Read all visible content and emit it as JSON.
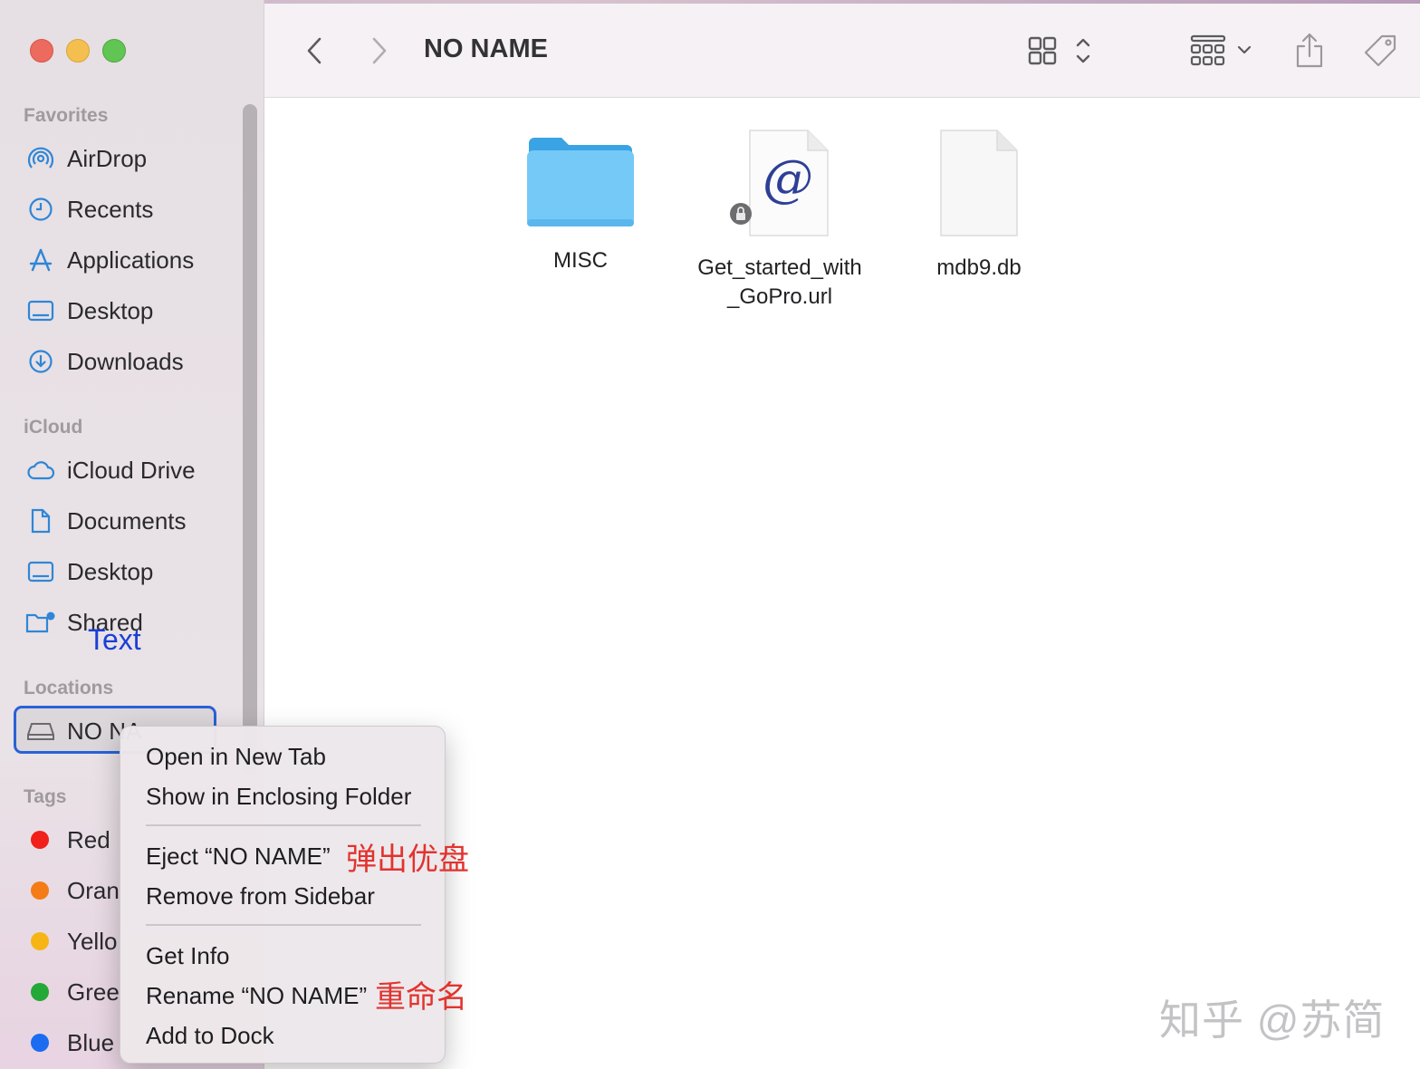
{
  "window": {
    "title": "NO NAME"
  },
  "sidebar": {
    "favorites_label": "Favorites",
    "favorites": [
      {
        "label": "AirDrop",
        "icon": "airdrop-icon"
      },
      {
        "label": "Recents",
        "icon": "clock-icon"
      },
      {
        "label": "Applications",
        "icon": "applications-icon"
      },
      {
        "label": "Desktop",
        "icon": "desktop-icon"
      },
      {
        "label": "Downloads",
        "icon": "download-icon"
      }
    ],
    "icloud_label": "iCloud",
    "icloud": [
      {
        "label": "iCloud Drive",
        "icon": "cloud-icon"
      },
      {
        "label": "Documents",
        "icon": "document-icon"
      },
      {
        "label": "Desktop",
        "icon": "desktop-icon"
      },
      {
        "label": "Shared",
        "icon": "shared-folder-icon"
      }
    ],
    "text_overlay": "Text",
    "locations_label": "Locations",
    "location_selected": {
      "label": "NO NA",
      "icon": "drive-icon"
    },
    "tags_label": "Tags",
    "tags": [
      {
        "label": "Red",
        "color": "#f0201a"
      },
      {
        "label": "Oran",
        "color": "#f47c16"
      },
      {
        "label": "Yello",
        "color": "#f7b515"
      },
      {
        "label": "Gree",
        "color": "#24a836"
      },
      {
        "label": "Blue",
        "color": "#1b6cf0"
      }
    ]
  },
  "toolbar": {
    "back_icon": "chevron-left-icon",
    "forward_icon": "chevron-right-icon",
    "view_icon": "icon-grid-icon",
    "group_icon": "group-grid-icon",
    "share_icon": "share-icon",
    "tag_icon": "tag-icon"
  },
  "files": [
    {
      "name": "MISC",
      "icon": "folder-icon"
    },
    {
      "name": "Get_started_with\n_GoPro.url",
      "name_line1": "Get_started_with",
      "name_line2": "_GoPro.url",
      "icon": "url-file-icon"
    },
    {
      "name": "mdb9.db",
      "icon": "blank-file-icon"
    }
  ],
  "context_menu": {
    "items": [
      "Open in New Tab",
      "Show in Enclosing Folder",
      "Eject “NO NAME”",
      "Remove from Sidebar",
      "Get Info",
      "Rename “NO NAME”",
      "Add to Dock"
    ],
    "annotation_eject": "弹出优盘",
    "annotation_rename": "重命名"
  },
  "watermark": "知乎 @苏简"
}
